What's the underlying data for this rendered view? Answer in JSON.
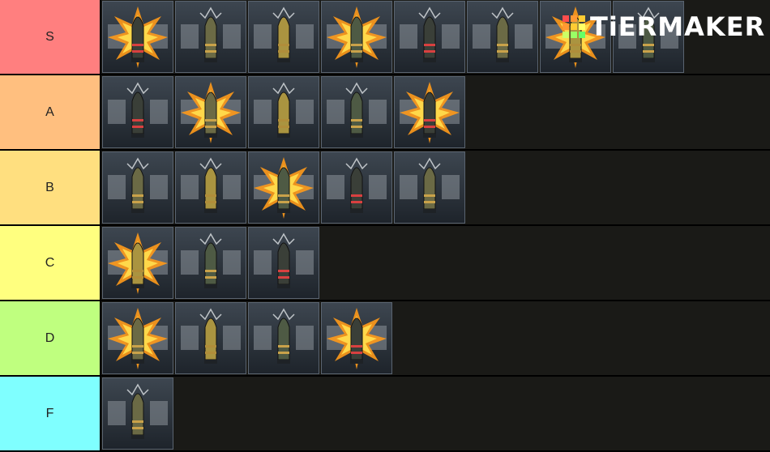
{
  "app": {
    "logo_text": "TiERMAKER"
  },
  "tiers": [
    {
      "label": "S",
      "color": "#ff7f7f",
      "items": [
        "shell-s1",
        "shell-s2",
        "shell-s3",
        "shell-s4",
        "shell-s5",
        "shell-s6",
        "shell-s7",
        "shell-s8"
      ]
    },
    {
      "label": "A",
      "color": "#ffbf7f",
      "items": [
        "shell-a1",
        "shell-a2",
        "shell-a3",
        "shell-a4",
        "shell-a5"
      ]
    },
    {
      "label": "B",
      "color": "#ffdf7f",
      "items": [
        "shell-b1",
        "shell-b2",
        "shell-b3",
        "shell-b4",
        "shell-b5"
      ]
    },
    {
      "label": "C",
      "color": "#ffff7f",
      "items": [
        "shell-c1",
        "shell-c2",
        "shell-c3"
      ]
    },
    {
      "label": "D",
      "color": "#bfff7f",
      "items": [
        "shell-d1",
        "shell-d2",
        "shell-d3",
        "shell-d4"
      ]
    },
    {
      "label": "F",
      "color": "#7fffff",
      "items": [
        "shell-f1"
      ]
    }
  ]
}
